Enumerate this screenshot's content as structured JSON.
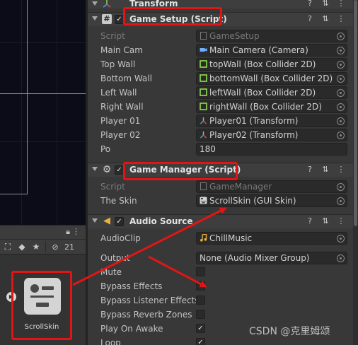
{
  "project": {
    "lock_icon": "lock-icon",
    "visible_count": "21",
    "asset": {
      "label": "ScrollSkin"
    }
  },
  "inspector": {
    "transform": {
      "title": "Transform"
    },
    "game_setup": {
      "title": "Game Setup (Script)",
      "rows": [
        {
          "label": "Script",
          "value": "GameSetup",
          "icon": "script-icon",
          "dim": true
        },
        {
          "label": "Main Cam",
          "value": "Main Camera (Camera)",
          "icon": "camera-icon"
        },
        {
          "label": "Top Wall",
          "value": "topWall (Box Collider 2D)",
          "icon": "box-collider-icon"
        },
        {
          "label": "Bottom Wall",
          "value": "bottomWall (Box Collider 2D)",
          "icon": "box-collider-icon"
        },
        {
          "label": "Left Wall",
          "value": "leftWall (Box Collider 2D)",
          "icon": "box-collider-icon"
        },
        {
          "label": "Right Wall",
          "value": "rightWall (Box Collider 2D)",
          "icon": "box-collider-icon"
        },
        {
          "label": "Player 01",
          "value": "Player01 (Transform)",
          "icon": "transform-icon"
        },
        {
          "label": "Player 02",
          "value": "Player02 (Transform)",
          "icon": "transform-icon"
        },
        {
          "label": "Po",
          "value": "180"
        }
      ]
    },
    "game_manager": {
      "title": "Game Manager (Script)",
      "rows": [
        {
          "label": "Script",
          "value": "GameManager",
          "icon": "script-icon",
          "dim": true
        },
        {
          "label": "The Skin",
          "value": "ScrollSkin (GUI Skin)",
          "icon": "gui-skin-icon"
        }
      ]
    },
    "audio_source": {
      "title": "Audio Source",
      "rows": [
        {
          "label": "AudioClip",
          "value": "ChillMusic",
          "icon": "audio-clip-icon"
        },
        {
          "label": "Output",
          "value": "None (Audio Mixer Group)"
        },
        {
          "label": "Mute",
          "checked": false
        },
        {
          "label": "Bypass Effects",
          "checked": false
        },
        {
          "label": "Bypass Listener Effects",
          "checked": false
        },
        {
          "label": "Bypass Reverb Zones",
          "checked": false
        },
        {
          "label": "Play On Awake",
          "checked": true
        },
        {
          "label": "Loop",
          "checked": true
        }
      ]
    }
  },
  "watermark": "CSDN @克里姆颂",
  "colors": {
    "highlight": "#e01616",
    "panel": "#383838",
    "field": "#2a2a2a"
  }
}
